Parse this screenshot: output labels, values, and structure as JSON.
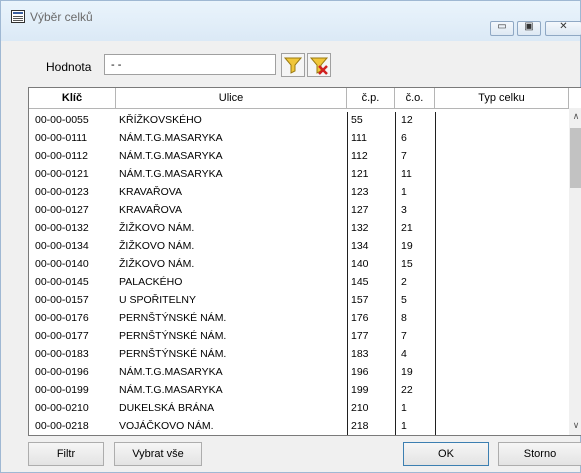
{
  "window": {
    "title": "Výběr celků"
  },
  "filter": {
    "label": "Hodnota",
    "value": "- -"
  },
  "columns": [
    "Klíč",
    "Ulice",
    "č.p.",
    "č.o.",
    "Typ celku"
  ],
  "rows": [
    {
      "klic": "00-00-0055",
      "ulice": "KŘÍŽKOVSKÉHO",
      "cp": "55",
      "co": "12"
    },
    {
      "klic": "00-00-0111",
      "ulice": "NÁM.T.G.MASARYKA",
      "cp": "111",
      "co": "6"
    },
    {
      "klic": "00-00-0112",
      "ulice": "NÁM.T.G.MASARYKA",
      "cp": "112",
      "co": "7"
    },
    {
      "klic": "00-00-0121",
      "ulice": "NÁM.T.G.MASARYKA",
      "cp": "121",
      "co": "11"
    },
    {
      "klic": "00-00-0123",
      "ulice": "KRAVAŘOVA",
      "cp": "123",
      "co": "1"
    },
    {
      "klic": "00-00-0127",
      "ulice": "KRAVAŘOVA",
      "cp": "127",
      "co": "3"
    },
    {
      "klic": "00-00-0132",
      "ulice": "ŽIŽKOVO NÁM.",
      "cp": "132",
      "co": "21"
    },
    {
      "klic": "00-00-0134",
      "ulice": "ŽIŽKOVO NÁM.",
      "cp": "134",
      "co": "19"
    },
    {
      "klic": "00-00-0140",
      "ulice": "ŽIŽKOVO NÁM.",
      "cp": "140",
      "co": "15"
    },
    {
      "klic": "00-00-0145",
      "ulice": "PALACKÉHO",
      "cp": "145",
      "co": "2"
    },
    {
      "klic": "00-00-0157",
      "ulice": "U SPOŘITELNY",
      "cp": "157",
      "co": "5"
    },
    {
      "klic": "00-00-0176",
      "ulice": "PERNŠTÝNSKÉ NÁM.",
      "cp": "176",
      "co": "8"
    },
    {
      "klic": "00-00-0177",
      "ulice": "PERNŠTÝNSKÉ NÁM.",
      "cp": "177",
      "co": "7"
    },
    {
      "klic": "00-00-0183",
      "ulice": "PERNŠTÝNSKÉ NÁM.",
      "cp": "183",
      "co": "4"
    },
    {
      "klic": "00-00-0196",
      "ulice": "NÁM.T.G.MASARYKA",
      "cp": "196",
      "co": "19"
    },
    {
      "klic": "00-00-0199",
      "ulice": "NÁM.T.G.MASARYKA",
      "cp": "199",
      "co": "22"
    },
    {
      "klic": "00-00-0210",
      "ulice": "DUKELSKÁ BRÁNA",
      "cp": "210",
      "co": "1"
    },
    {
      "klic": "00-00-0218",
      "ulice": "VOJÁČKOVO NÁM.",
      "cp": "218",
      "co": "1"
    }
  ],
  "buttons": {
    "filtr": "Filtr",
    "vybrat": "Vybrat vše",
    "ok": "OK",
    "storno": "Storno"
  },
  "icons": {
    "title": "list-window-icon",
    "filter": "funnel-icon",
    "clear": "funnel-clear-icon"
  }
}
